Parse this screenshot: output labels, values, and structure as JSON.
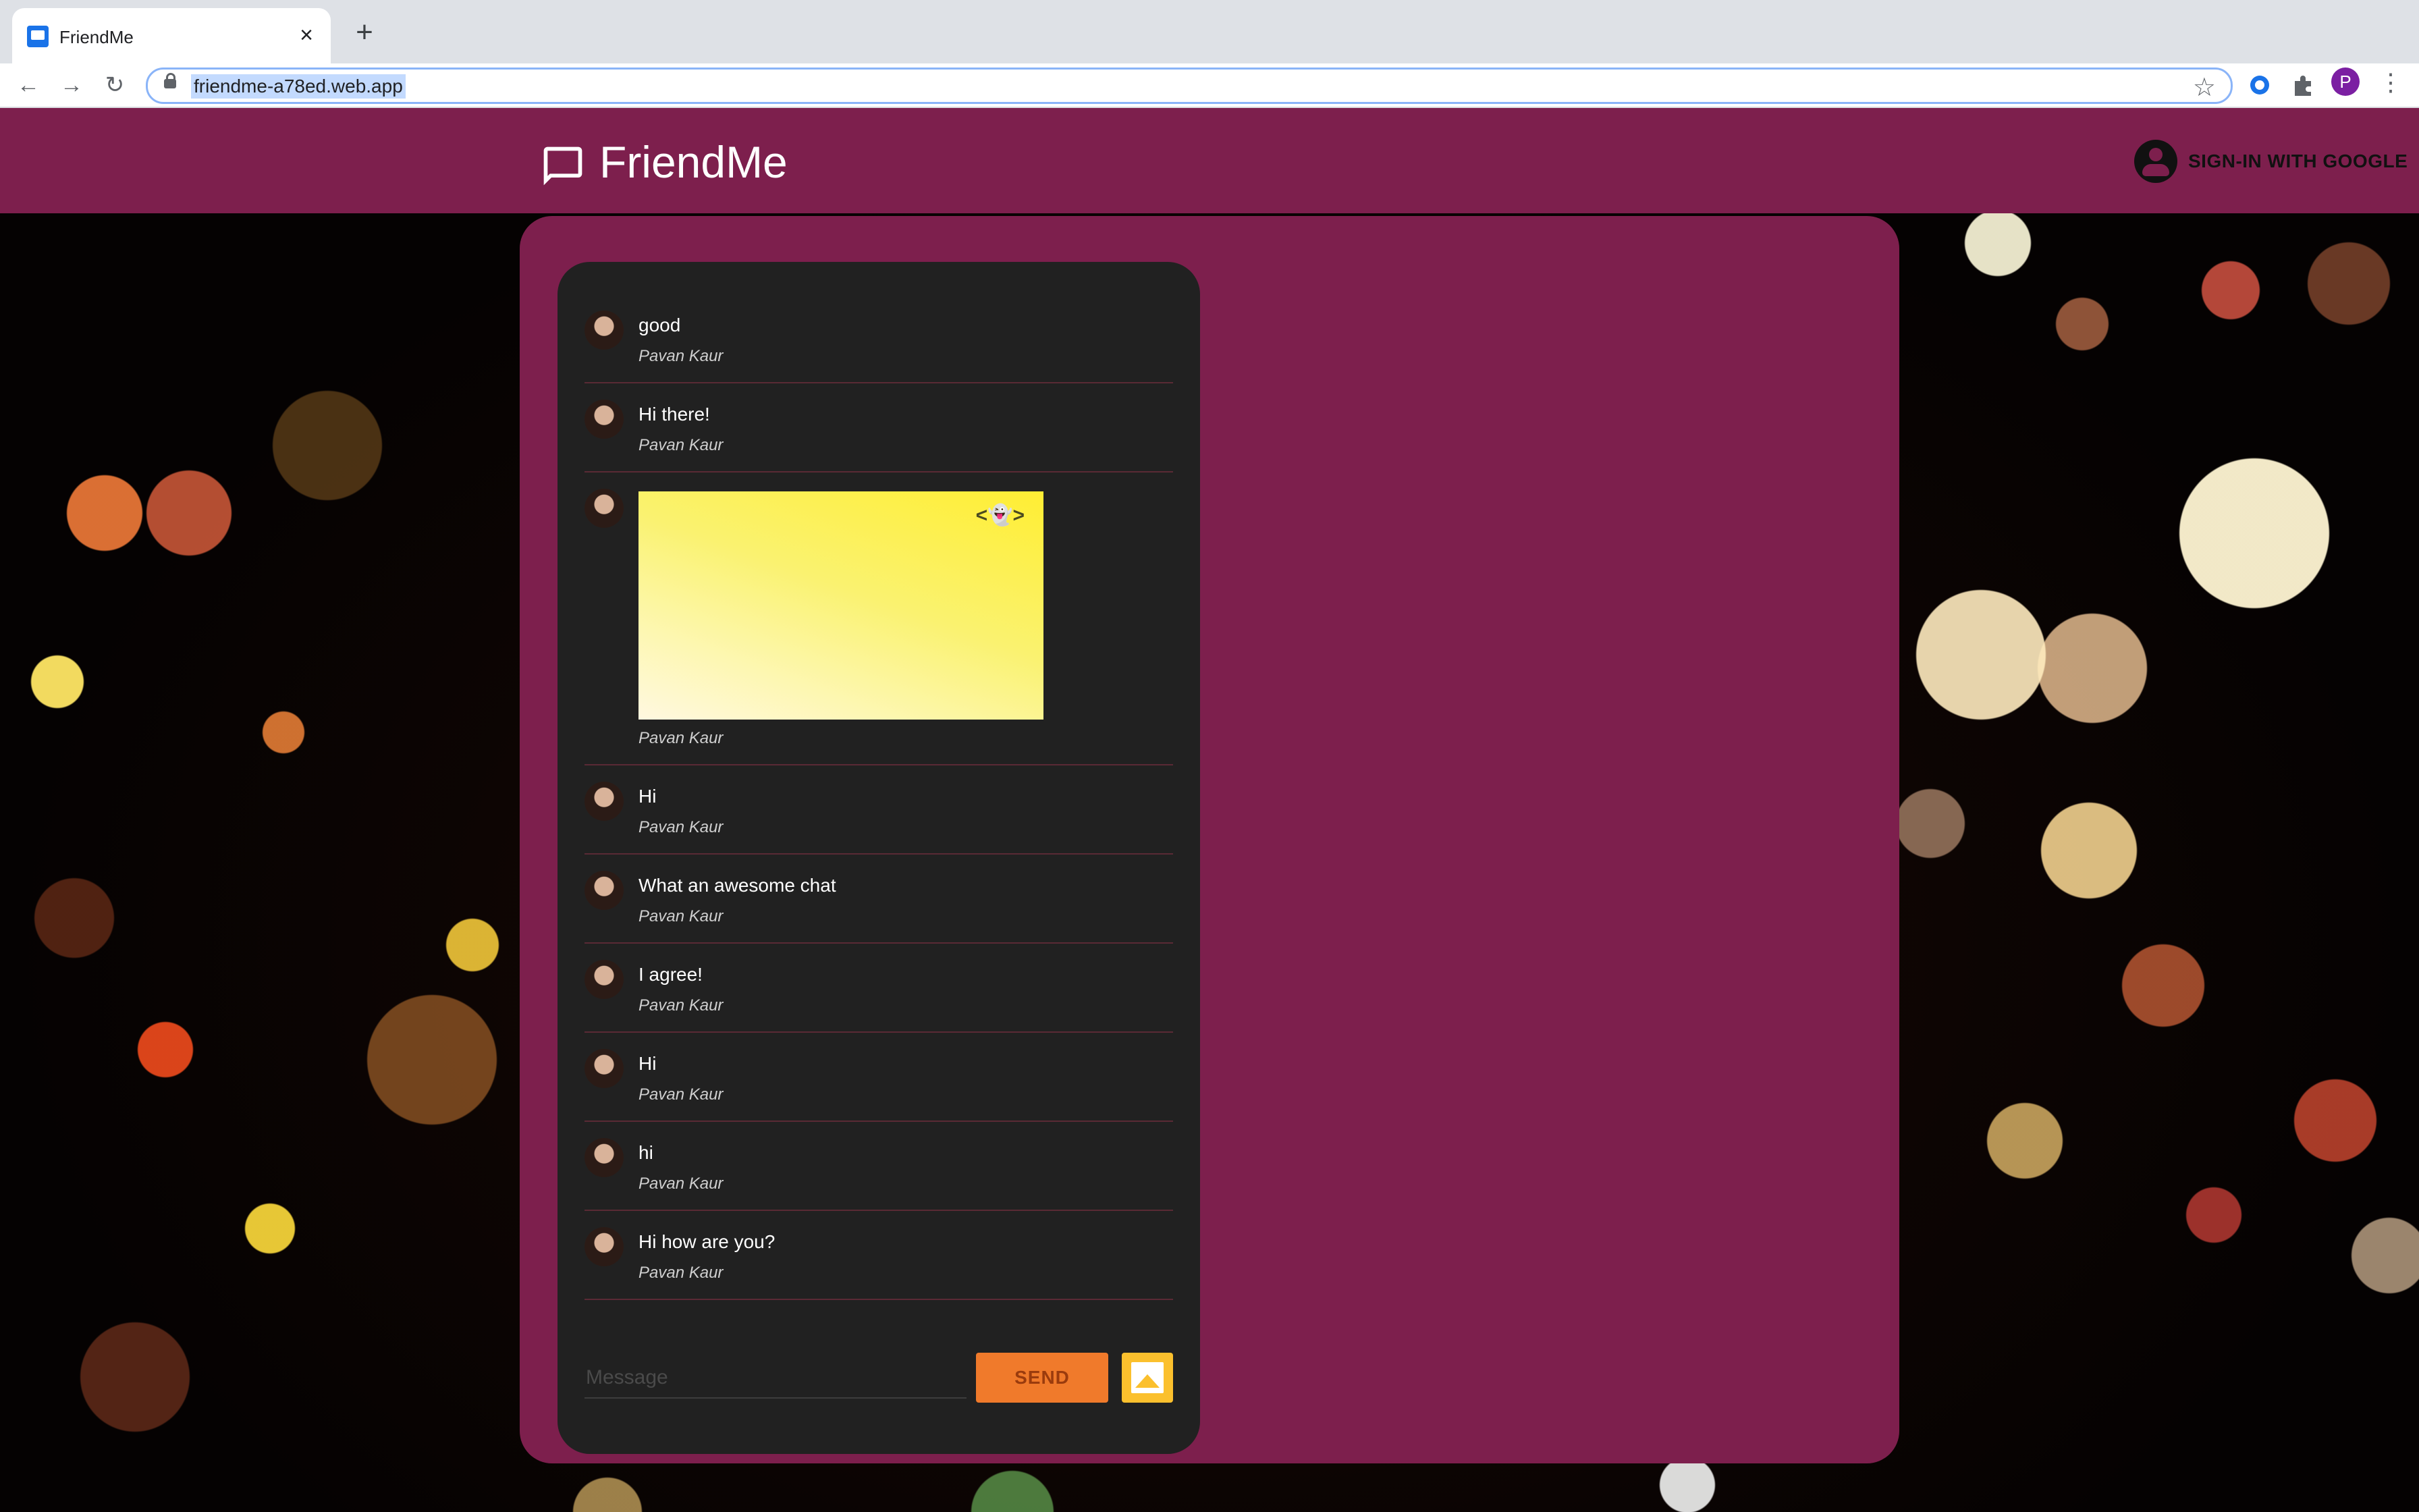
{
  "browser": {
    "tab_title": "FriendMe",
    "tab_close": "×",
    "new_tab": "+",
    "back": "←",
    "forward": "→",
    "reload": "↻",
    "url": "friendme-a78ed.web.app",
    "star": "☆",
    "profile_initial": "P",
    "menu": "⋮"
  },
  "app": {
    "title": "FriendMe",
    "signin_label": "SIGN-IN WITH GOOGLE"
  },
  "messages": [
    {
      "text": "good",
      "author": "Pavan Kaur"
    },
    {
      "text": "Hi there!",
      "author": "Pavan Kaur"
    },
    {
      "image": true,
      "overlay": "<👻>",
      "author": "Pavan Kaur"
    },
    {
      "text": "Hi",
      "author": "Pavan Kaur"
    },
    {
      "text": "What an awesome chat",
      "author": "Pavan Kaur"
    },
    {
      "text": "I agree!",
      "author": "Pavan Kaur"
    },
    {
      "text": "Hi",
      "author": "Pavan Kaur"
    },
    {
      "text": "hi",
      "author": "Pavan Kaur"
    },
    {
      "text": "Hi how are you?",
      "author": "Pavan Kaur"
    }
  ],
  "composer": {
    "placeholder": "Message",
    "send_label": "SEND"
  },
  "colors": {
    "brand": "#7d1f4d",
    "card": "#212121",
    "send": "#f07a2b",
    "image_button": "#fbc02d"
  }
}
